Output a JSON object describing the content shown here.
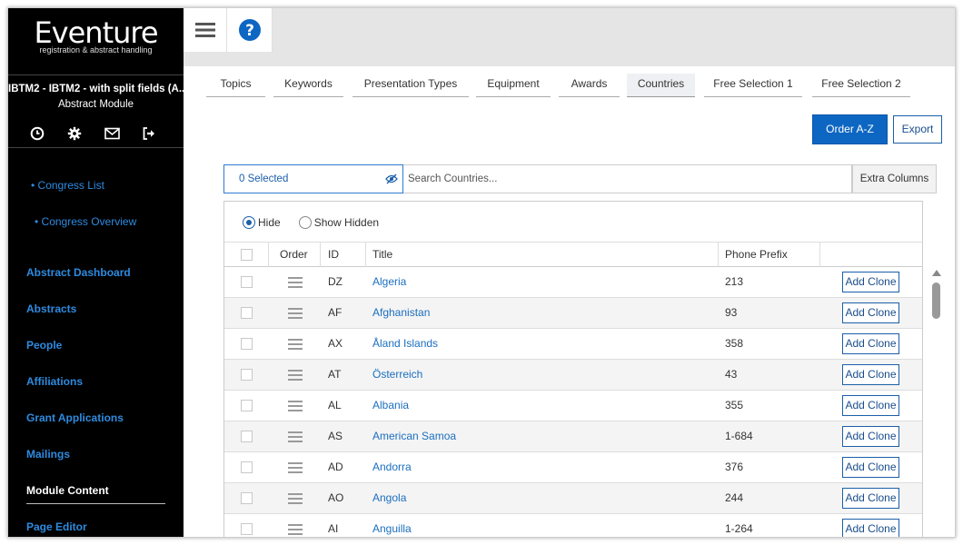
{
  "sidebar": {
    "logo": "Eventure",
    "logo_sub": "registration & abstract handling",
    "project_title": "IBTM2 - IBTM2 - with split fields (A...",
    "project_sub": "Abstract Module",
    "icons": [
      "clock-icon",
      "gear-icon",
      "mail-icon",
      "logout-icon"
    ],
    "sub_links": [
      "• Congress List",
      "• Congress Overview"
    ],
    "menu": [
      "Abstract Dashboard",
      "Abstracts",
      "People",
      "Affiliations",
      "Grant Applications",
      "Mailings",
      "Module Content",
      "Page Editor"
    ],
    "active_item": "Module Content"
  },
  "topbar": {
    "menu_icon": "hamburger-icon",
    "help_icon": "help-icon"
  },
  "tabs": [
    "Topics",
    "Keywords",
    "Presentation Types",
    "Equipment",
    "Awards",
    "Countries",
    "Free Selection 1",
    "Free Selection 2"
  ],
  "active_tab": "Countries",
  "toolbar": {
    "order_label": "Order A-Z",
    "export_label": "Export"
  },
  "filter": {
    "selected_label": "0 Selected",
    "search_placeholder": "Search Countries...",
    "extra_columns_label": "Extra Columns"
  },
  "visibility": {
    "hide_label": "Hide",
    "show_hidden_label": "Show Hidden",
    "selected": "Hide"
  },
  "table": {
    "headers": {
      "order": "Order",
      "id": "ID",
      "title": "Title",
      "phone": "Phone Prefix"
    },
    "action_label": "Add Clone",
    "rows": [
      {
        "id": "DZ",
        "title": "Algeria",
        "phone": "213"
      },
      {
        "id": "AF",
        "title": "Afghanistan",
        "phone": "93"
      },
      {
        "id": "AX",
        "title": "Åland Islands",
        "phone": "358"
      },
      {
        "id": "AT",
        "title": "Österreich",
        "phone": "43"
      },
      {
        "id": "AL",
        "title": "Albania",
        "phone": "355"
      },
      {
        "id": "AS",
        "title": "American Samoa",
        "phone": "1-684"
      },
      {
        "id": "AD",
        "title": "Andorra",
        "phone": "376"
      },
      {
        "id": "AO",
        "title": "Angola",
        "phone": "244"
      },
      {
        "id": "AI",
        "title": "Anguilla",
        "phone": "1-264"
      }
    ]
  },
  "colors": {
    "accent": "#0d66c2",
    "link": "#2d8be0",
    "sidebar_bg": "#000000"
  }
}
